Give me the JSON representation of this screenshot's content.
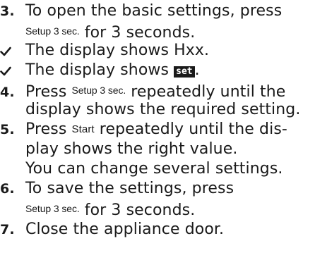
{
  "steps": {
    "step3": {
      "number": "3.",
      "lead": "To open the basic settings, press",
      "key": "Setup 3 sec.",
      "tail": " for 3 seconds."
    },
    "result1": {
      "text": "The display shows Hxx."
    },
    "result2": {
      "lead": "The display shows ",
      "display": "set",
      "tail": "."
    },
    "step4": {
      "number": "4.",
      "lead": "Press ",
      "key": "Setup 3 sec.",
      "tail": " repeatedly until the",
      "line2": "display shows the required setting."
    },
    "step5": {
      "number": "5.",
      "lead": "Press ",
      "key": "Start",
      "tail": " repeatedly until the dis-",
      "line2": "play shows the right value.",
      "line3": "You can change several settings."
    },
    "step6": {
      "number": "6.",
      "lead": "To save the settings, press",
      "key": "Setup 3 sec.",
      "tail": " for 3 seconds."
    },
    "step7": {
      "number": "7.",
      "text": "Close the appliance door."
    }
  },
  "icons": {
    "result": "checkmark-icon"
  }
}
